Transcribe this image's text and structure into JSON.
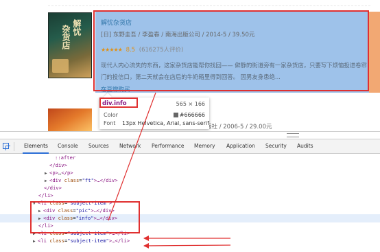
{
  "page": {
    "book1": {
      "cover_title_a": "解忧",
      "cover_title_b": "杂货店",
      "title": "解忧杂货店",
      "pub": "[日] 东野圭吾 / 李盈春 / 南海出版公司 / 2014-5 / 39.50元",
      "stars": "★★★★★",
      "score": "8.5",
      "rating_count": "(616275人评价)",
      "desc": "现代人内心流失的东西，这家杂货店能帮你找回—— 僻静的街道旁有一家杂货店，只要写下烦恼投进卷帘门的投信口，第二天就会在店后的牛奶箱里得到回答。 因男友身患绝...",
      "buy": "在豆瓣购买"
    },
    "book2": {
      "pub": "版社 / 2006-5 / 29.00元"
    }
  },
  "tooltip": {
    "name": "div.info",
    "size": "565 × 166",
    "color_label": "Color",
    "color_value": "#666666",
    "font_label": "Font",
    "font_value": "13px Helvetica, Arial, sans-serif",
    "swatch_color": "#666666"
  },
  "devtools": {
    "tabs": [
      "Elements",
      "Console",
      "Sources",
      "Network",
      "Performance",
      "Memory",
      "Application",
      "Security",
      "Audits"
    ],
    "active_tab": "Elements",
    "dom": {
      "l1": "::after",
      "l2_tag": "</div>",
      "l3_open": "<p>",
      "l3_ellipsis": "…",
      "l3_close": "</p>",
      "l4_tag_open": "<div",
      "l4_attr": "class",
      "l4_val": "\"ft\"",
      "l4_rest": ">…</div>",
      "l5": "</div>",
      "l6": "</li>",
      "l7_tag": "<li",
      "l7_attr": "class",
      "l7_val": "\"subject-item\"",
      "l7_end": ">",
      "l8_tag": "<div",
      "l8_attr": "class",
      "l8_val": "\"pic\"",
      "l8_rest": ">…</div>",
      "l9_tag": "<div",
      "l9_attr": "class",
      "l9_val": "\"info\"",
      "l9_rest": ">…</div>",
      "l10": "</li>",
      "l11_tag": "<li",
      "l11_attr": "class",
      "l11_val": "\"subject-item\"",
      "l11_rest": ">…</li>",
      "l12_tag": "<li",
      "l12_attr": "class",
      "l12_val": "\"subject-item\"",
      "l12_rest": ">…</li>"
    }
  },
  "colors": {
    "highlight_overlay": "#9ec2ea",
    "annotation_red": "#e03030",
    "margin_orange": "#f2a873",
    "selected_row": "#e4eefb"
  }
}
